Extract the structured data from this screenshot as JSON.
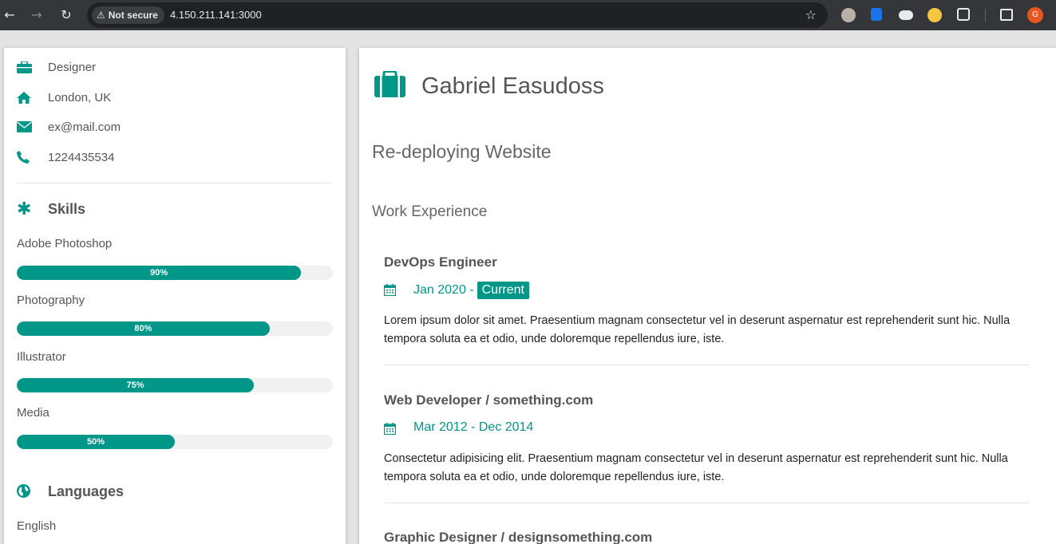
{
  "browser": {
    "security_label": "Not secure",
    "url": "4.150.211.141:3000",
    "profile_initial": "G"
  },
  "sidebar": {
    "info": [
      {
        "icon": "briefcase-icon",
        "text": "Designer"
      },
      {
        "icon": "home-icon",
        "text": "London, UK"
      },
      {
        "icon": "envelope-icon",
        "text": "ex@mail.com"
      },
      {
        "icon": "phone-icon",
        "text": "1224435534"
      }
    ],
    "skills_title": "Skills",
    "skills": [
      {
        "name": "Adobe Photoshop",
        "percent": 90,
        "label": "90%"
      },
      {
        "name": "Photography",
        "percent": 80,
        "label": "80%"
      },
      {
        "name": "Illustrator",
        "percent": 75,
        "label": "75%"
      },
      {
        "name": "Media",
        "percent": 50,
        "label": "50%"
      }
    ],
    "languages_title": "Languages",
    "languages": [
      {
        "name": "English"
      }
    ]
  },
  "main": {
    "name": "Gabriel Easudoss",
    "subtitle": "Re-deploying Website",
    "section_title": "Work Experience",
    "jobs": [
      {
        "title": "DevOps Engineer",
        "date": "Jan 2020 -",
        "tag": "Current",
        "desc": "Lorem ipsum dolor sit amet. Praesentium magnam consectetur vel in deserunt aspernatur est reprehenderit sunt hic. Nulla tempora soluta ea et odio, unde doloremque repellendus iure, iste."
      },
      {
        "title": "Web Developer / something.com",
        "date": "Mar 2012 - Dec 2014",
        "desc": "Consectetur adipisicing elit. Praesentium magnam consectetur vel in deserunt aspernatur est reprehenderit sunt hic. Nulla tempora soluta ea et odio, unde doloremque repellendus iure, iste."
      },
      {
        "title": "Graphic Designer / designsomething.com"
      }
    ]
  },
  "colors": {
    "accent": "#009688",
    "chrome": "#35363a"
  }
}
